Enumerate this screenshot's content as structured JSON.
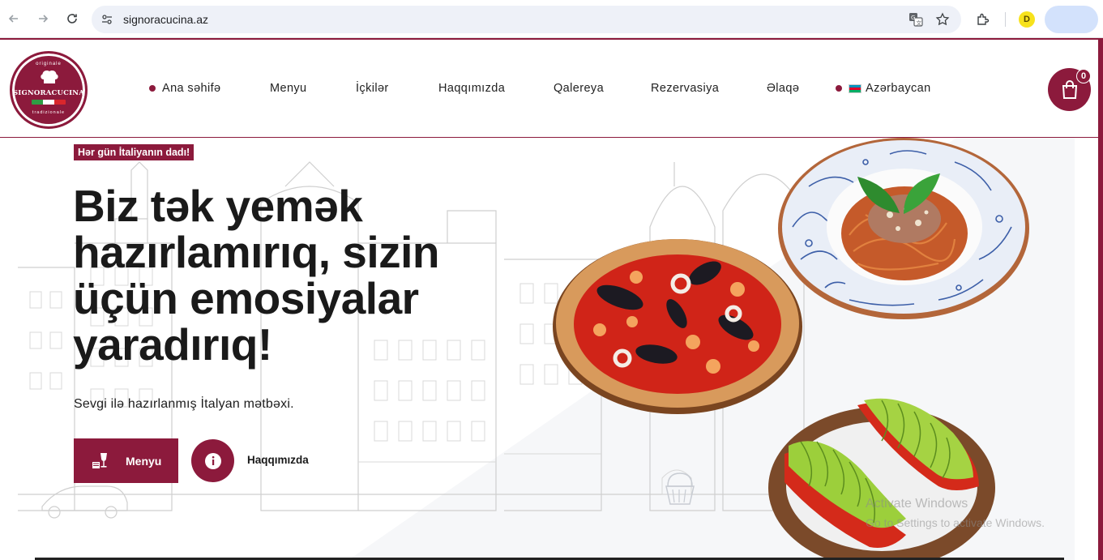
{
  "browser": {
    "url": "signoracucina.az",
    "profile_initial": "D",
    "icons": [
      "back-icon",
      "forward-icon",
      "reload-icon",
      "site-settings-icon",
      "translate-icon",
      "star-icon",
      "extensions-icon"
    ]
  },
  "header": {
    "logo": {
      "top_text": "originale",
      "name": "SIGNORACUCINA",
      "bottom_text": "tradizionale"
    },
    "menu": [
      {
        "label": "Ana səhifə",
        "active": true
      },
      {
        "label": "Menyu"
      },
      {
        "label": "İçkilər"
      },
      {
        "label": "Haqqımızda"
      },
      {
        "label": "Qalereya"
      },
      {
        "label": "Rezervasiya"
      },
      {
        "label": "Əlaqə"
      },
      {
        "label": "Azərbaycan",
        "flag": "az"
      }
    ],
    "cart_count": "0"
  },
  "hero": {
    "tagline": "Hər gün İtaliyanın dadı!",
    "headline": "Biz tək yemək hazırlamırıq, sizin üçün emosiyalar yaradırıq!",
    "subtitle": "Sevgi ilə hazırlanmış İtalyan mətbəxi.",
    "menu_button": "Menyu",
    "about_button": "Haqqımızda"
  },
  "watermark": {
    "title": "Activate Windows",
    "subtitle": "Go to Settings to activate Windows."
  },
  "colors": {
    "brand": "#8c1a3c",
    "text": "#1a1a1a"
  }
}
